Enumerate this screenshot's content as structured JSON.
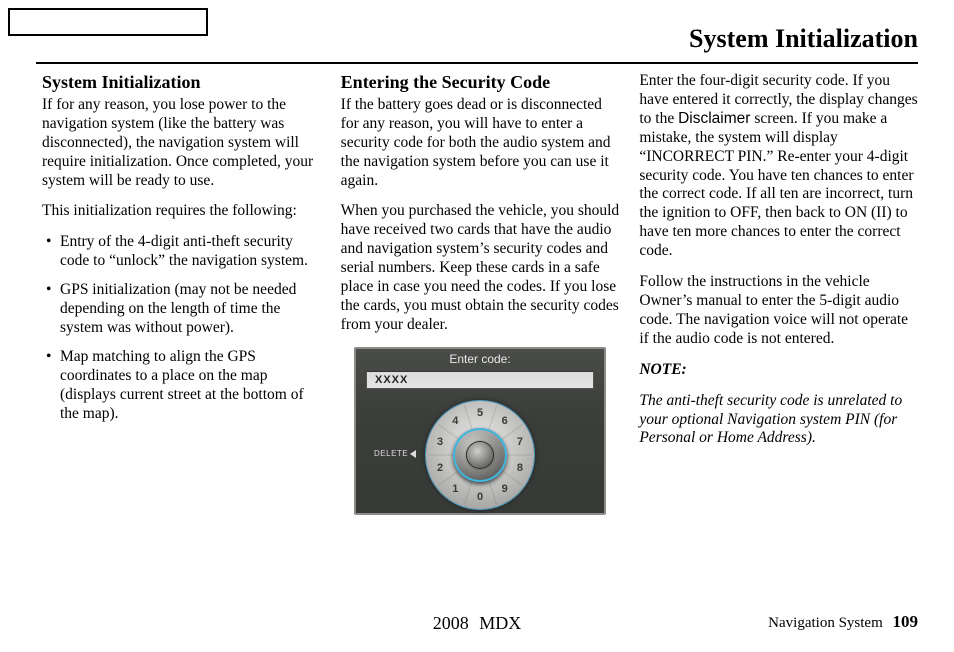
{
  "page_title": "System Initialization",
  "col1": {
    "heading": "System Initialization",
    "p1": "If for any reason, you lose power to the navigation system (like the battery was disconnected), the navigation system will require initialization. Once completed, your system will be ready to use.",
    "p2": "This initialization requires the following:",
    "bullets": [
      "Entry of the 4-digit anti-theft security code to “unlock” the navigation system.",
      "GPS initialization (may not be needed depending on the length of time the system was without power).",
      "Map matching to align the GPS coordinates to a place on the map (displays current street at the bottom of the map)."
    ]
  },
  "col2": {
    "heading": "Entering the Security Code",
    "p1": "If the battery goes dead or is disconnected for any reason, you will have to enter a security code for both the audio system and the navigation system before you can use it again.",
    "p2": "When you purchased the vehicle, you should have received two cards that have the audio and navigation system’s security codes and serial numbers. Keep these cards in a safe place in case you need the codes. If you lose the cards, you must obtain the security codes from your dealer.",
    "screenshot": {
      "title": "Enter code:",
      "value": "XXXX",
      "delete": "DELETE",
      "numbers": [
        "0",
        "1",
        "2",
        "3",
        "4",
        "5",
        "6",
        "7",
        "8",
        "9"
      ]
    }
  },
  "col3": {
    "p1a": "Enter the four-digit security code. If you have entered it correctly, the display changes to the ",
    "p1b": "Disclaimer",
    "p1c": " screen. If you make a mistake, the system will display “INCORRECT PIN.” Re-enter your 4-digit security code. You have ten chances to enter the correct code. If all ten are incorrect, turn the ignition to OFF, then back to ON (II) to have ten more chances to enter the correct code.",
    "p2": "Follow the instructions in the vehicle Owner’s manual to enter the 5-digit audio code. The navigation voice will not operate if the audio code is not entered.",
    "note_label": "NOTE:",
    "note": "The anti-theft security code is unrelated to your optional Navigation system PIN (for Personal or Home Address)."
  },
  "footer": {
    "center": "2008  MDX",
    "right_label": "Navigation System",
    "page": "109"
  }
}
